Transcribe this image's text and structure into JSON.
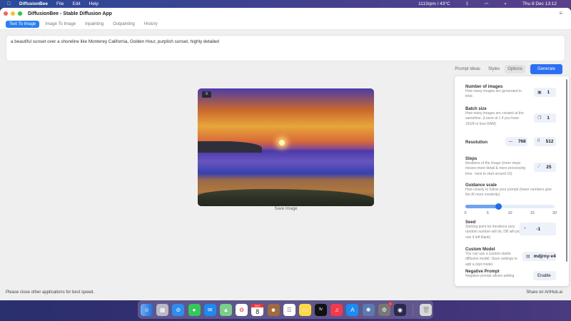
{
  "menubar": {
    "app": "DiffusionBee",
    "items": [
      "File",
      "Edit",
      "Help"
    ],
    "status": "1113rpm / 43°C",
    "clock": "Thu 8 Dec  13:12"
  },
  "window": {
    "title": "DiffusionBee - Stable Diffusion App"
  },
  "tabs": [
    {
      "label": "Text To Image",
      "active": true
    },
    {
      "label": "Image To Image"
    },
    {
      "label": "Inpainting"
    },
    {
      "label": "Outpainting"
    },
    {
      "label": "History"
    }
  ],
  "prompt": {
    "value": "a beautiful sunset over a shoreline like Monterey California, Golden Hour, purplish sunset, highly detailed"
  },
  "actions": {
    "prompt_ideas": "Prompt Ideas",
    "styles": "Styles",
    "options": "Options",
    "generate": "Generate"
  },
  "image": {
    "save_label": "Save Image"
  },
  "options": {
    "num_images": {
      "title": "Number of images",
      "desc": "How many images are generated in total.",
      "value": "1"
    },
    "batch": {
      "title": "Batch size",
      "desc": "How many images are created at the sametime. (Leave at 1 if you have 16GB or less RAM)",
      "value": "1"
    },
    "resolution": {
      "title": "Resolution",
      "width": "768",
      "height": "512"
    },
    "steps": {
      "title": "Steps",
      "desc": "Iterations of the image (more steps means more detail & more processing time - best to start around 10)",
      "value": "25"
    },
    "guidance": {
      "title": "Guidance scale",
      "desc": "How closely to follow your prompt (lower numbers give the AI more creativity)",
      "value": 7.5,
      "min": 0,
      "max": 20,
      "ticks": [
        "0",
        "5",
        "10",
        "15",
        "20"
      ]
    },
    "seed": {
      "title": "Seed",
      "desc": "Starting point for iterations (any random number will do; DB will pick one if left blank)",
      "value": "-1"
    },
    "model": {
      "title": "Custom Model",
      "desc": "You can use a custom stable diffusion model. Open settings to add a ckpt model.",
      "value": "mdjrny-v4"
    },
    "negative": {
      "title": "Negative Prompt",
      "desc": "Negative prompt allows adding",
      "button": "Enable"
    }
  },
  "footer": {
    "left": "Please close other applications for best speed.",
    "right": "Share on ArtHub.ai"
  },
  "dock": {
    "calendar_month": "DEC",
    "calendar_day": "8",
    "tv": "tv",
    "settings_badge": "1"
  },
  "colors": {
    "accent": "#2a6ff5"
  }
}
